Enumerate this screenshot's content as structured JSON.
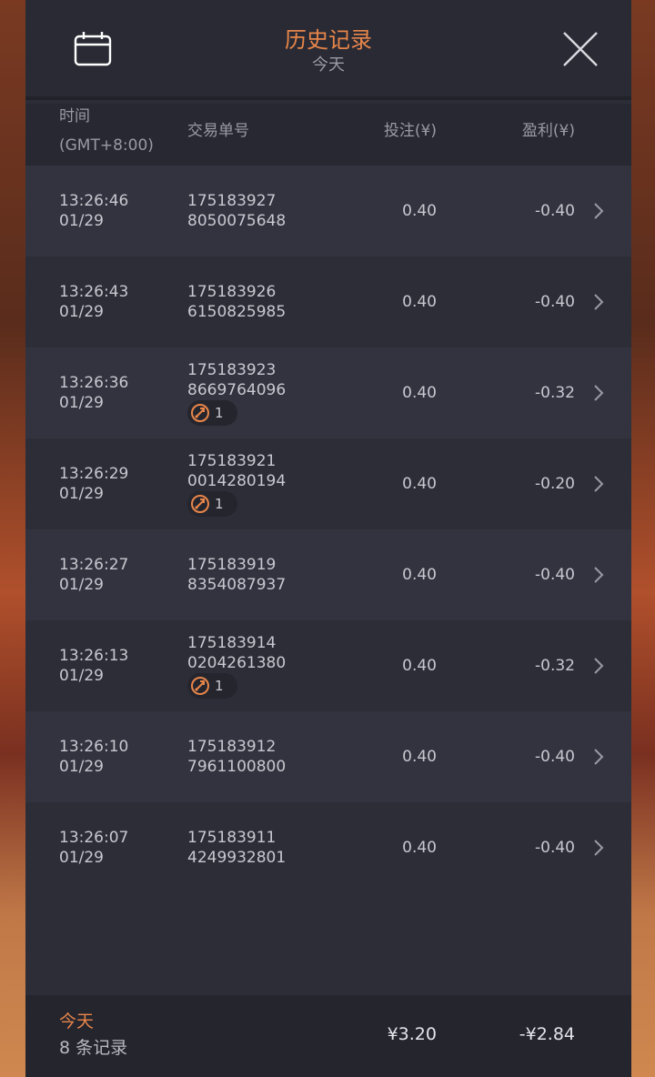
{
  "header": {
    "title": "历史记录",
    "subtitle": "今天",
    "calendar_icon": "calendar-icon",
    "close_icon": "close-icon",
    "accent_color": "#e8864a"
  },
  "columns": {
    "time": "时间",
    "timezone": "(GMT+8:00)",
    "order": "交易单号",
    "bet": "投注(¥)",
    "profit": "盈利(¥)"
  },
  "rows": [
    {
      "time": "13:26:46",
      "date": "01/29",
      "order1": "175183927",
      "order2": "8050075648",
      "badge": null,
      "bet": "0.40",
      "profit": "-0.40"
    },
    {
      "time": "13:26:43",
      "date": "01/29",
      "order1": "175183926",
      "order2": "6150825985",
      "badge": null,
      "bet": "0.40",
      "profit": "-0.40"
    },
    {
      "time": "13:26:36",
      "date": "01/29",
      "order1": "175183923",
      "order2": "8669764096",
      "badge": "1",
      "bet": "0.40",
      "profit": "-0.32"
    },
    {
      "time": "13:26:29",
      "date": "01/29",
      "order1": "175183921",
      "order2": "0014280194",
      "badge": "1",
      "bet": "0.40",
      "profit": "-0.20"
    },
    {
      "time": "13:26:27",
      "date": "01/29",
      "order1": "175183919",
      "order2": "8354087937",
      "badge": null,
      "bet": "0.40",
      "profit": "-0.40"
    },
    {
      "time": "13:26:13",
      "date": "01/29",
      "order1": "175183914",
      "order2": "0204261380",
      "badge": "1",
      "bet": "0.40",
      "profit": "-0.32"
    },
    {
      "time": "13:26:10",
      "date": "01/29",
      "order1": "175183912",
      "order2": "7961100800",
      "badge": null,
      "bet": "0.40",
      "profit": "-0.40"
    },
    {
      "time": "13:26:07",
      "date": "01/29",
      "order1": "175183911",
      "order2": "4249932801",
      "badge": null,
      "bet": "0.40",
      "profit": "-0.40"
    }
  ],
  "footer": {
    "label": "今天",
    "count": "8 条记录",
    "total_bet": "¥3.20",
    "total_profit": "-¥2.84"
  }
}
